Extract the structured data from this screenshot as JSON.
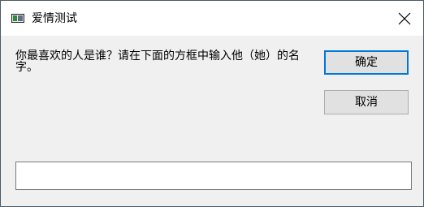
{
  "window": {
    "title": "爱情测试"
  },
  "dialog": {
    "prompt": "你最喜欢的人是谁？请在下面的方框中输入他（她）的名字。",
    "ok_label": "确定",
    "cancel_label": "取消",
    "input_value": ""
  },
  "icons": {
    "app": "app-window-icon",
    "close": "close-icon"
  }
}
